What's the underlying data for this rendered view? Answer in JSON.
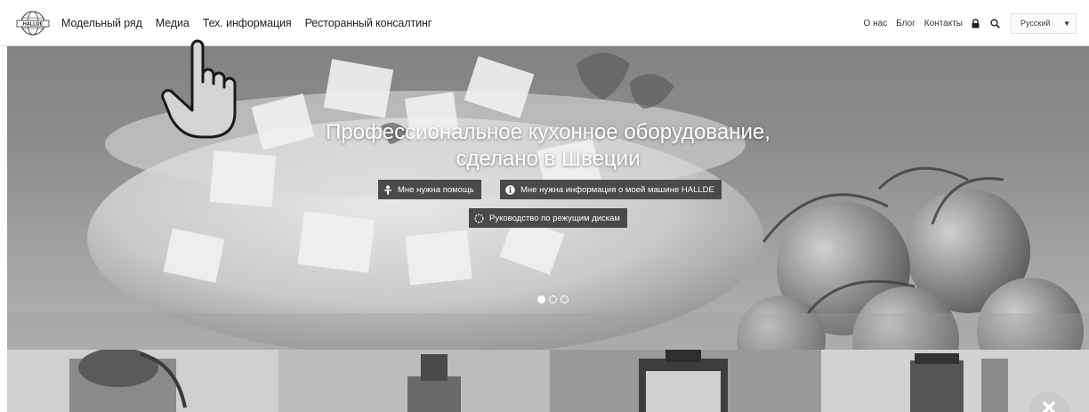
{
  "brand": {
    "logo_text": "HALLDE",
    "logo_icon": "globe-logo-icon"
  },
  "nav": {
    "left": [
      "Модельный ряд",
      "Медиа",
      "Тех. информация",
      "Ресторанный консалтинг"
    ],
    "right": [
      "О нас",
      "Блог",
      "Контакты"
    ],
    "icons": [
      "lock-icon",
      "search-icon"
    ],
    "language": {
      "value": "Русский",
      "icon": "chevron-down-icon"
    }
  },
  "hero": {
    "title_line1": "Профессиональное кухонное оборудование,",
    "title_line2": "сделано в Швеции",
    "buttons": {
      "help": {
        "label": "Мне нужна помощь",
        "icon": "person-help-icon"
      },
      "info": {
        "label": "Мне нужна информация о моей машине HALLDE",
        "icon": "info-icon"
      },
      "discs": {
        "label": "Руководство по режущим дискам",
        "icon": "disc-icon"
      }
    },
    "carousel": {
      "slides": 3,
      "active": 1
    }
  },
  "overlay": {
    "pointer_icon": "hand-pointer-icon",
    "close_icon": "close-icon"
  },
  "colors": {
    "button_bg": "#4a4a4a",
    "nav_text": "#222222",
    "hero_text": "#ffffff"
  }
}
